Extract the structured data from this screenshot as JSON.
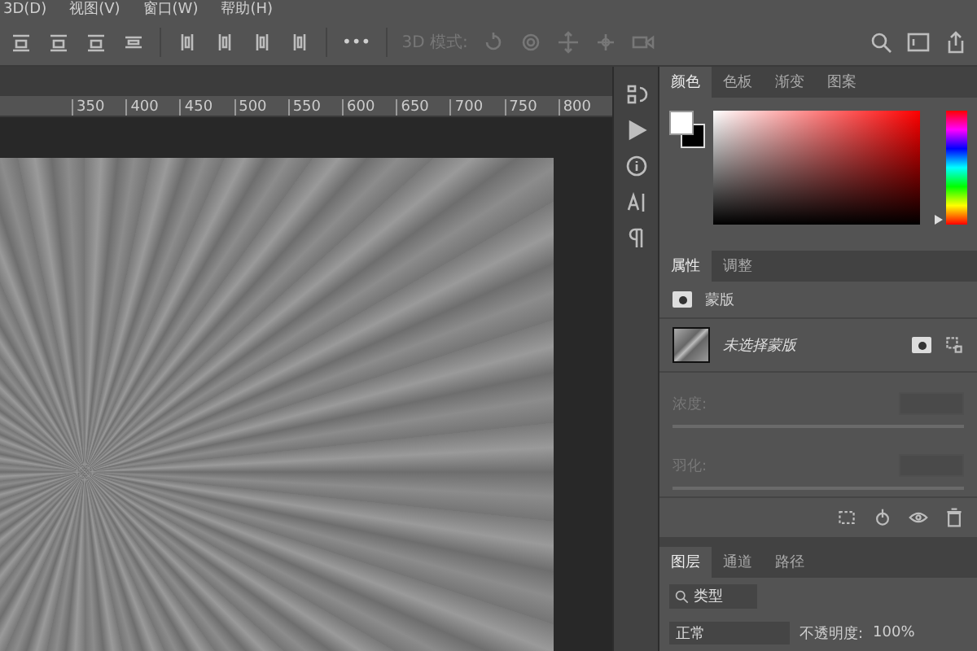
{
  "menu": [
    {
      "label": "3D(D)"
    },
    {
      "label": "视图(V)"
    },
    {
      "label": "窗口(W)"
    },
    {
      "label": "帮助(H)"
    }
  ],
  "options_bar": {
    "mode": {
      "label": "3D 模式:",
      "disabled": true
    },
    "more": "•••"
  },
  "ruler": {
    "labels": [
      "350",
      "400",
      "450",
      "500",
      "550",
      "600",
      "650",
      "700",
      "750",
      "800"
    ]
  },
  "color_panel": {
    "tabs": [
      {
        "label": "颜色",
        "selected": true
      },
      {
        "label": "色板",
        "selected": false
      },
      {
        "label": "渐变",
        "selected": false
      },
      {
        "label": "图案",
        "selected": false
      }
    ],
    "hue": {
      "level": 0
    }
  },
  "properties_panel": {
    "tabs": [
      {
        "label": "属性",
        "selected": true
      },
      {
        "label": "调整",
        "selected": false
      }
    ],
    "section": "蒙版",
    "mask_label": "未选择蒙版",
    "fields": [
      {
        "label": "浓度:",
        "disabled": true
      },
      {
        "label": "羽化:",
        "disabled": true
      }
    ]
  },
  "layers_panel": {
    "tabs": [
      {
        "label": "图层",
        "selected": true
      },
      {
        "label": "通道",
        "selected": false
      },
      {
        "label": "路径",
        "selected": false
      }
    ],
    "filter": "类型",
    "blend_mode": "正常",
    "opacity_label": "不透明度:",
    "opacity": "100%"
  }
}
